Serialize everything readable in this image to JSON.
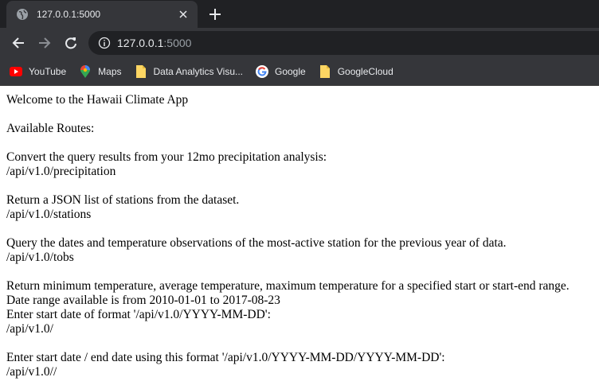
{
  "browser": {
    "tab_title": "127.0.0.1:5000",
    "url_host": "127.0.0.1",
    "url_port": ":5000",
    "bookmarks": [
      {
        "label": "YouTube",
        "icon": "youtube-icon"
      },
      {
        "label": "Maps",
        "icon": "maps-icon"
      },
      {
        "label": "Data Analytics Visu...",
        "icon": "folder-icon"
      },
      {
        "label": "Google",
        "icon": "google-icon"
      },
      {
        "label": "GoogleCloud",
        "icon": "folder-icon"
      }
    ]
  },
  "page": {
    "welcome": "Welcome to the Hawaii Climate App",
    "routes_heading": "Available Routes:",
    "precip_desc": "Convert the query results from your 12mo precipitation analysis:",
    "precip_route": "/api/v1.0/precipitation",
    "stations_desc": "Return a JSON list of stations from the dataset.",
    "stations_route": "/api/v1.0/stations",
    "tobs_desc": "Query the dates and temperature observations of the most-active station for the previous year of data.",
    "tobs_route": "/api/v1.0/tobs",
    "temp_desc": "Return minimum temperature, average temperature, maximum temperature for a specified start or start-end range.",
    "date_range": "Date range available is from 2010-01-01 to 2017-08-23",
    "start_format": "Enter start date of format '/api/v1.0/YYYY-MM-DD':",
    "start_route": "/api/v1.0/",
    "range_format": "Enter start date / end date using this format '/api/v1.0/YYYY-MM-DD/YYYY-MM-DD':",
    "range_route": "/api/v1.0//"
  }
}
